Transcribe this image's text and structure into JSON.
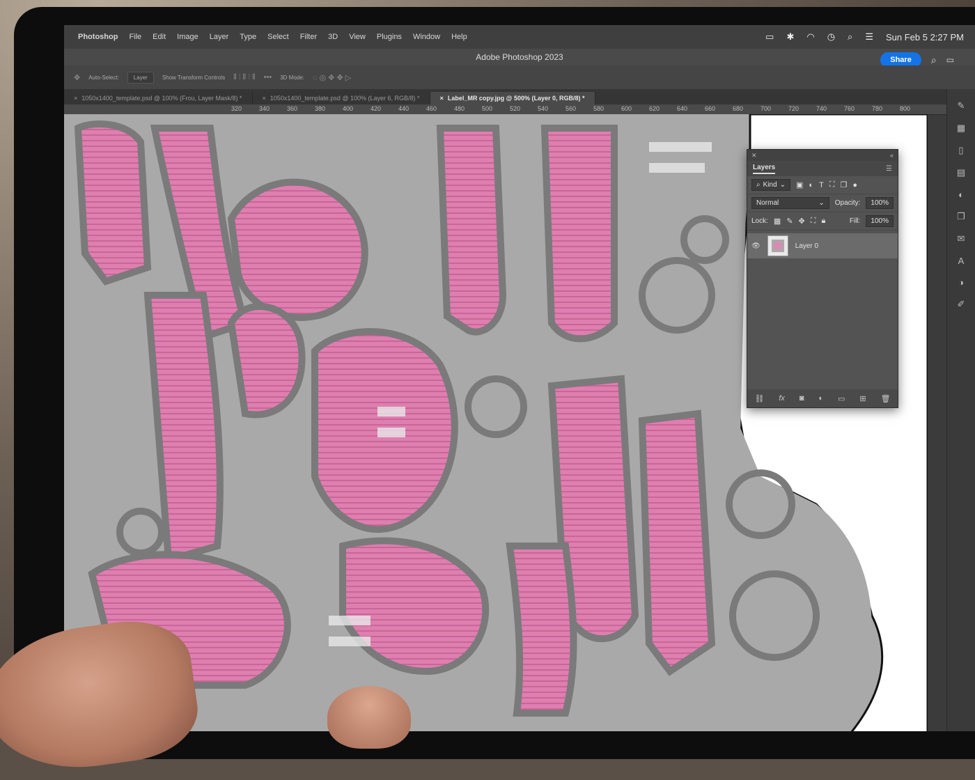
{
  "menubar": {
    "items": [
      "Photoshop",
      "File",
      "Edit",
      "Image",
      "Layer",
      "Type",
      "Select",
      "Filter",
      "3D",
      "View",
      "Plugins",
      "Window",
      "Help"
    ],
    "datetime": "Sun Feb 5  2:27 PM"
  },
  "window": {
    "title": "Adobe Photoshop 2023",
    "share_label": "Share"
  },
  "options": {
    "auto_select": "Auto-Select:",
    "target": "Layer",
    "transform": "Show Transform Controls",
    "mode": "3D Mode:"
  },
  "tabs": [
    "1050x1400_template.psd @ 100% (Frou, Layer Mask/8) *",
    "1050x1400_template.psd @ 100% (Layer 6, RGB/8) *",
    "Label_MR copy.jpg @ 500% (Layer 0, RGB/8) *"
  ],
  "ruler": [
    "320",
    "340",
    "360",
    "380",
    "400",
    "420",
    "440",
    "460",
    "480",
    "500",
    "520",
    "540",
    "560",
    "580",
    "600",
    "620",
    "640",
    "660",
    "680",
    "700",
    "720",
    "740",
    "760",
    "780",
    "800"
  ],
  "layers_panel": {
    "title": "Layers",
    "filter": "Kind",
    "blend": "Normal",
    "opacity_label": "Opacity:",
    "opacity": "100%",
    "lock_label": "Lock:",
    "fill_label": "Fill:",
    "fill": "100%",
    "layer_name": "Layer 0"
  },
  "colors": {
    "accent": "#1473e6",
    "pink": "#de7fb0",
    "canvas_gray": "#a9a9a9"
  }
}
